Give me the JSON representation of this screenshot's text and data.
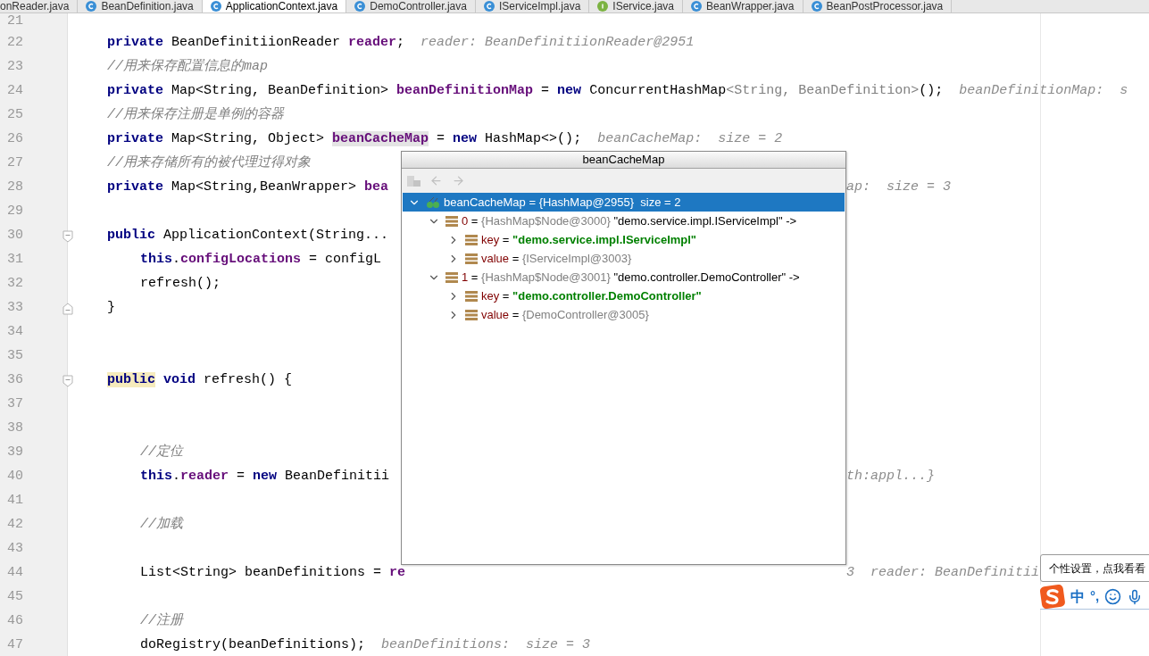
{
  "tabs": [
    {
      "label": "onReader.java",
      "selected": false
    },
    {
      "label": "BeanDefinition.java",
      "kind": "class",
      "selected": false
    },
    {
      "label": "ApplicationContext.java",
      "kind": "class",
      "selected": true
    },
    {
      "label": "DemoController.java",
      "kind": "class",
      "selected": false
    },
    {
      "label": "IServiceImpl.java",
      "kind": "class",
      "selected": false
    },
    {
      "label": "IService.java",
      "kind": "interface",
      "selected": false
    },
    {
      "label": "BeanWrapper.java",
      "kind": "class",
      "selected": false
    },
    {
      "label": "BeanPostProcessor.java",
      "kind": "class",
      "selected": false
    }
  ],
  "editor": {
    "lines": [
      {
        "number": "21",
        "kind": "member"
      },
      {
        "number": "22",
        "kind": "member",
        "segments": [
          {
            "kind": "keyword",
            "text": "private "
          },
          {
            "kind": "plain",
            "text": "BeanDefinitiionReader "
          },
          {
            "kind": "field",
            "text": "reader"
          },
          {
            "kind": "plain",
            "text": ";  "
          },
          {
            "kind": "hint",
            "text": "reader: BeanDefinitiionReader@2951"
          }
        ]
      },
      {
        "number": "23",
        "kind": "member",
        "segments": [
          {
            "kind": "comment",
            "text": "//用来保存配置信息的map"
          }
        ]
      },
      {
        "number": "24",
        "kind": "member",
        "segments": [
          {
            "kind": "keyword",
            "text": "private "
          },
          {
            "kind": "plain",
            "text": "Map<String, BeanDefinition> "
          },
          {
            "kind": "field",
            "text": "beanDefinitionMap"
          },
          {
            "kind": "plain",
            "text": " = "
          },
          {
            "kind": "keyword",
            "text": "new "
          },
          {
            "kind": "plain",
            "text": "ConcurrentHashMap"
          },
          {
            "kind": "dim",
            "text": "<String, BeanDefinition>"
          },
          {
            "kind": "plain",
            "text": "();  "
          },
          {
            "kind": "hint",
            "text": "beanDefinitionMap:  s"
          }
        ]
      },
      {
        "number": "25",
        "kind": "member",
        "segments": [
          {
            "kind": "comment",
            "text": "//用来保存注册是单例的容器"
          }
        ]
      },
      {
        "number": "26",
        "kind": "member",
        "segments": [
          {
            "kind": "keyword",
            "text": "private "
          },
          {
            "kind": "plain",
            "text": "Map<String, Object> "
          },
          {
            "kind": "field_marked",
            "text": "beanCacheMap"
          },
          {
            "kind": "plain",
            "text": " = "
          },
          {
            "kind": "keyword",
            "text": "new "
          },
          {
            "kind": "plain",
            "text": "HashMap<>();  "
          },
          {
            "kind": "hint",
            "text": "beanCacheMap:  size = 2"
          }
        ]
      },
      {
        "number": "27",
        "kind": "member",
        "segments": [
          {
            "kind": "comment",
            "text": "//用来存储所有的被代理过得对象"
          }
        ]
      },
      {
        "number": "28",
        "kind": "member",
        "segments": [
          {
            "kind": "keyword",
            "text": "private "
          },
          {
            "kind": "plain",
            "text": "Map<String,BeanWrapper> "
          },
          {
            "kind": "field",
            "text": "bea"
          }
        ],
        "tail": [
          {
            "kind": "hint",
            "text": "ap:  size = 3"
          }
        ]
      },
      {
        "number": "29",
        "kind": "member"
      },
      {
        "number": "30",
        "kind": "fold-open",
        "segments": [
          {
            "kind": "keyword",
            "text": "public "
          },
          {
            "kind": "plain",
            "text": "ApplicationContext(String..."
          }
        ]
      },
      {
        "number": "31",
        "kind": "body",
        "segments": [
          {
            "kind": "keyword",
            "text": "this"
          },
          {
            "kind": "plain",
            "text": "."
          },
          {
            "kind": "field",
            "text": "configLocations"
          },
          {
            "kind": "plain",
            "text": " = configL"
          }
        ]
      },
      {
        "number": "32",
        "kind": "body",
        "segments": [
          {
            "kind": "plain",
            "text": "refresh();"
          }
        ]
      },
      {
        "number": "33",
        "kind": "fold-close",
        "segments": [
          {
            "kind": "plain",
            "text": "}"
          }
        ]
      },
      {
        "number": "34",
        "kind": "member"
      },
      {
        "number": "35",
        "kind": "member"
      },
      {
        "number": "36",
        "kind": "fold-open",
        "segments": [
          {
            "kind": "keyword_marked",
            "text": "public"
          },
          {
            "kind": "keyword",
            "text": " void "
          },
          {
            "kind": "plain",
            "text": "refresh() {"
          }
        ]
      },
      {
        "number": "37",
        "kind": "body"
      },
      {
        "number": "38",
        "kind": "body"
      },
      {
        "number": "39",
        "kind": "body",
        "segments": [
          {
            "kind": "comment",
            "text": "//定位"
          }
        ]
      },
      {
        "number": "40",
        "kind": "body",
        "segments": [
          {
            "kind": "keyword",
            "text": "this"
          },
          {
            "kind": "plain",
            "text": "."
          },
          {
            "kind": "field",
            "text": "reader"
          },
          {
            "kind": "plain",
            "text": " = "
          },
          {
            "kind": "keyword",
            "text": "new "
          },
          {
            "kind": "plain",
            "text": "BeanDefinitii"
          }
        ],
        "tail": [
          {
            "kind": "hint",
            "text": "th:appl...}"
          }
        ]
      },
      {
        "number": "41",
        "kind": "body"
      },
      {
        "number": "42",
        "kind": "body",
        "segments": [
          {
            "kind": "comment",
            "text": "//加载"
          }
        ]
      },
      {
        "number": "43",
        "kind": "body"
      },
      {
        "number": "44",
        "kind": "body",
        "segments": [
          {
            "kind": "plain",
            "text": "List<String> beanDefinitions = "
          },
          {
            "kind": "field",
            "text": "re"
          }
        ],
        "tail": [
          {
            "kind": "hint",
            "text": "3  reader: BeanDefinitii"
          }
        ]
      },
      {
        "number": "45",
        "kind": "body"
      },
      {
        "number": "46",
        "kind": "body",
        "segments": [
          {
            "kind": "comment",
            "text": "//注册"
          }
        ]
      },
      {
        "number": "47",
        "kind": "body",
        "segments": [
          {
            "kind": "plain",
            "text": "doRegistry(beanDefinitions);  "
          },
          {
            "kind": "hint",
            "text": "beanDefinitions:  size = 3"
          }
        ]
      }
    ]
  },
  "popup": {
    "title": "beanCacheMap",
    "tree": [
      {
        "kind": "watch",
        "name": "beanCacheMap",
        "operator": "=",
        "value": "{HashMap@2955}",
        "detail": "size = 2",
        "expanded": true,
        "selected": true,
        "children": [
          {
            "kind": "field",
            "name": "0",
            "operator": "=",
            "value": "{HashMap$Node@3000}",
            "detail": "\"demo.service.impl.IServiceImpl\" ->",
            "expanded": true,
            "selected": false,
            "children": [
              {
                "kind": "string-field",
                "name": "key",
                "operator": "=",
                "value": "\"demo.service.impl.IServiceImpl\"",
                "expanded": false,
                "selected": false
              },
              {
                "kind": "field",
                "name": "value",
                "operator": "=",
                "value": "{IServiceImpl@3003}",
                "expanded": false,
                "selected": false
              }
            ]
          },
          {
            "kind": "field",
            "name": "1",
            "operator": "=",
            "value": "{HashMap$Node@3001}",
            "detail": "\"demo.controller.DemoController\" ->",
            "expanded": true,
            "selected": false,
            "children": [
              {
                "kind": "string-field",
                "name": "key",
                "operator": "=",
                "value": "\"demo.controller.DemoController\"",
                "expanded": false,
                "selected": false
              },
              {
                "kind": "field",
                "name": "value",
                "operator": "=",
                "value": "{DemoController@3005}",
                "expanded": false,
                "selected": false
              }
            ]
          }
        ]
      }
    ]
  },
  "ime": {
    "tooltip": "个性设置，点我看看",
    "mode": "中",
    "punctuation": "°,"
  }
}
